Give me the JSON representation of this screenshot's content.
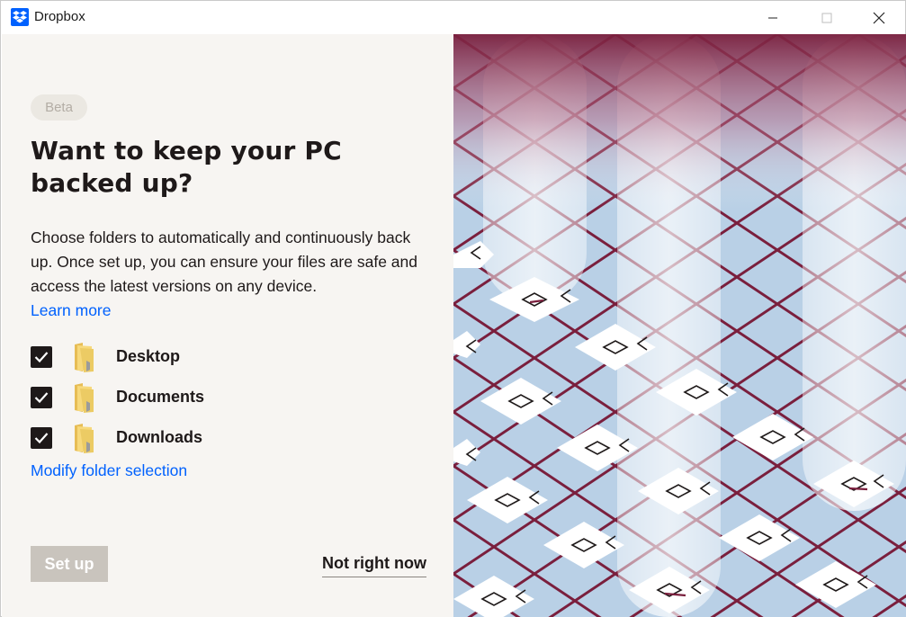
{
  "window": {
    "title": "Dropbox",
    "app_icon": "dropbox-logo-icon",
    "controls": [
      "minimize-icon",
      "maximize-icon",
      "close-icon"
    ]
  },
  "badge": "Beta",
  "heading": "Want to keep your PC backed up?",
  "description": "Choose folders to automatically and continuously back up. Once set up, you can ensure your files are safe and access the latest versions on any device.",
  "learn_more": "Learn more",
  "folders": [
    {
      "label": "Desktop",
      "checked": true
    },
    {
      "label": "Documents",
      "checked": true
    },
    {
      "label": "Downloads",
      "checked": true
    }
  ],
  "modify_link": "Modify folder selection",
  "buttons": {
    "setup": "Set up",
    "not_now": "Not right now"
  },
  "colors": {
    "accent": "#0061fe",
    "panel_bg": "#f7f5f2",
    "text": "#1e1919",
    "disabled_button": "#c9c4bd",
    "illustration_bg": "#b9d0e6",
    "illustration_lines": "#7a1f3d"
  }
}
